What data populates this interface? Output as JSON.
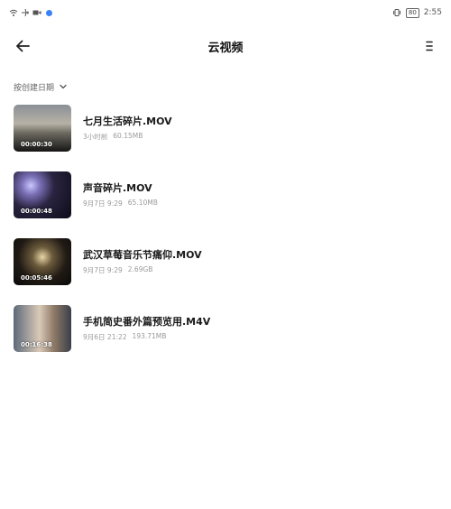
{
  "status_bar": {
    "time": "2:55",
    "battery": "80"
  },
  "header": {
    "title": "云视频"
  },
  "sort": {
    "label": "按创建日期"
  },
  "videos": [
    {
      "name": "七月生活碎片.MOV",
      "date": "3小时前",
      "size": "60.15MB",
      "duration": "00:00:30"
    },
    {
      "name": "声音碎片.MOV",
      "date": "9月7日 9:29",
      "size": "65.10MB",
      "duration": "00:00:48"
    },
    {
      "name": "武汉草莓音乐节痛仰.MOV",
      "date": "9月7日 9:29",
      "size": "2.69GB",
      "duration": "00:05:46"
    },
    {
      "name": "手机简史番外篇预览用.M4V",
      "date": "9月6日 21:22",
      "size": "193.71MB",
      "duration": "00:16:38"
    }
  ],
  "icons": {
    "back": "arrow-left-icon",
    "menu": "menu-icon",
    "sort_chevron": "chevron-down-icon"
  }
}
